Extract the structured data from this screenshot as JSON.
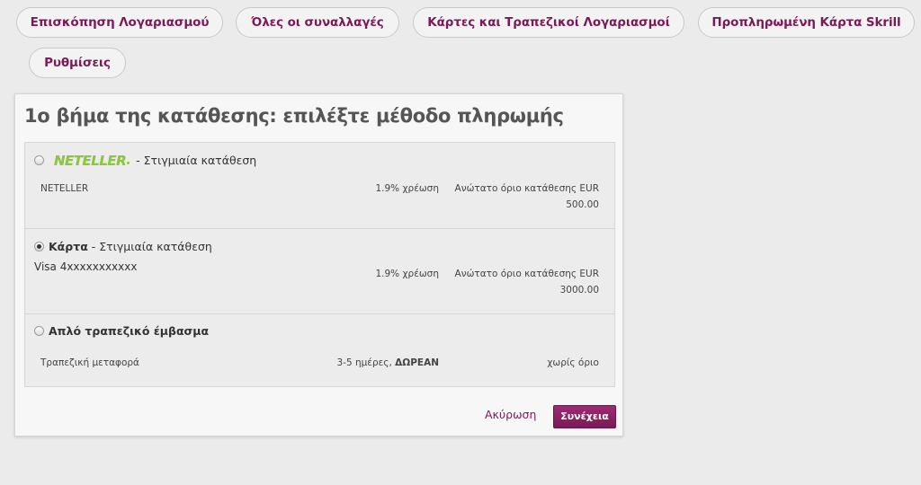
{
  "nav": {
    "tabs": [
      {
        "label": "Επισκόπηση Λογαριασμού"
      },
      {
        "label": "Όλες οι συναλλαγές"
      },
      {
        "label": "Κάρτες και Τραπεζικοί Λογαριασμοί"
      },
      {
        "label": "Προπληρωμένη Κάρτα Skrill"
      },
      {
        "label": "Ρυθμίσεις"
      }
    ]
  },
  "deposit": {
    "title": "1ο βήμα της κατάθεσης: επιλέξτε μέθοδο πληρωμής",
    "methods": [
      {
        "logo_text": "NETELLER",
        "suffix": " - Στιγμιαία κατάθεση",
        "name": "NETELLER",
        "fee": "1.9% χρέωση",
        "limit_label": "Ανώτατο όριο κατάθεσης EUR",
        "limit_value": "500.00",
        "selected": false
      },
      {
        "title": "Κάρτα",
        "suffix": " - Στιγμιαία κατάθεση",
        "detail": "Visa 4xxxxxxxxxxx",
        "fee": "1.9% χρέωση",
        "limit_label": "Ανώτατο όριο κατάθεσης EUR",
        "limit_value": "3000.00",
        "selected": true
      },
      {
        "title": "Απλό τραπεζικό έμβασμα",
        "name": "Τραπεζική μεταφορά",
        "duration": "3-5 ημέρες, ",
        "fee_strong": "ΔΩΡΕΑΝ",
        "limit_text": "χωρίς όριο",
        "selected": false
      }
    ],
    "cancel_label": "Ακύρωση",
    "continue_label": "Συνέχεια"
  },
  "colors": {
    "accent": "#7a1a56",
    "neteller_green": "#8dc63f",
    "background": "#ebebeb"
  }
}
